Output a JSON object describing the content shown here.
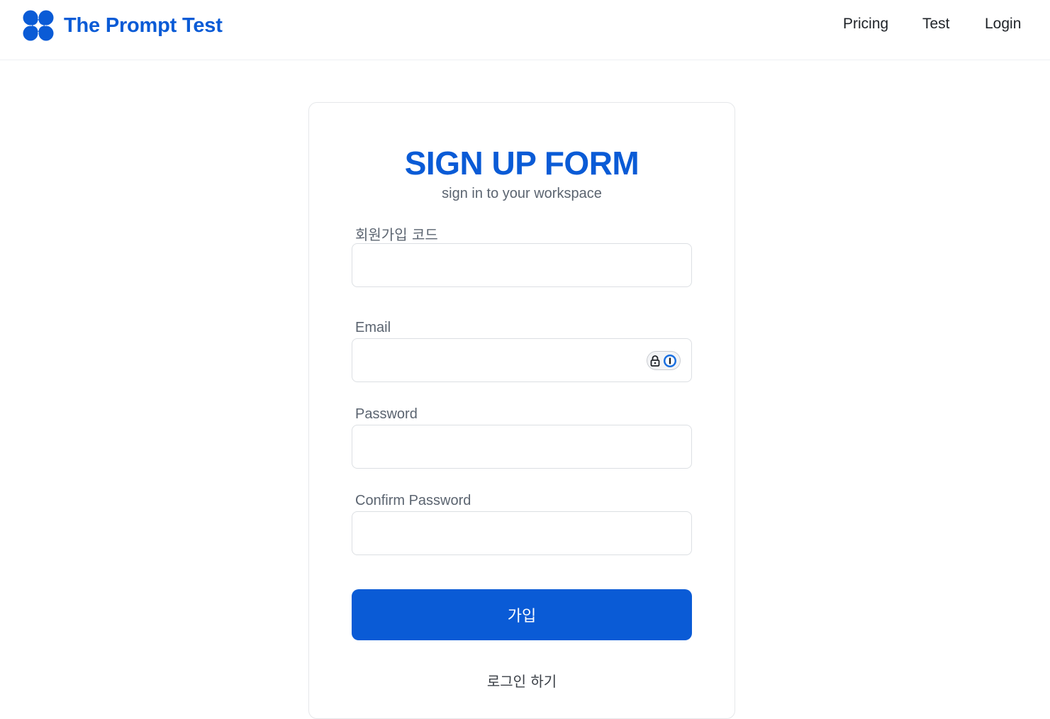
{
  "header": {
    "brand_name": "The Prompt Test",
    "brand_logo_icon": "four-circle-clover-icon",
    "nav": {
      "pricing": "Pricing",
      "test": "Test",
      "login": "Login"
    }
  },
  "form": {
    "title": "SIGN UP FORM",
    "subtitle": "sign in to your workspace",
    "fields": {
      "signup_code": {
        "label": "회원가입 코드",
        "value": ""
      },
      "email": {
        "label": "Email",
        "value": ""
      },
      "password": {
        "label": "Password",
        "value": ""
      },
      "confirm_password": {
        "label": "Confirm Password",
        "value": ""
      }
    },
    "password_manager_badge_icon": "password-manager-icon",
    "submit_label": "가입",
    "login_link": "로그인 하기"
  },
  "colors": {
    "brand": "#0a5bd6",
    "text": "#1f2328",
    "muted": "#5b6470",
    "border": "#dcdfe3"
  }
}
